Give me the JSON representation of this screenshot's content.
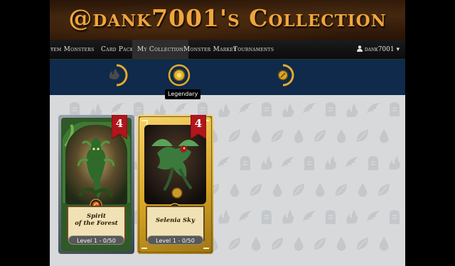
{
  "banner": {
    "title": "@dank7001's Collection"
  },
  "nav": {
    "items": [
      {
        "label": "ŧem Monsters",
        "active": false
      },
      {
        "label": "Card Packs",
        "active": false
      },
      {
        "label": "My Collection",
        "active": true
      },
      {
        "label": "Monster Market",
        "active": false
      },
      {
        "label": "Tournaments",
        "active": false
      }
    ],
    "user": "dank7001"
  },
  "filters": {
    "buttons": [
      "fire-element-icon",
      "legendary-rarity-icon",
      "gold-foil-icon"
    ],
    "tooltip": "Legendary"
  },
  "cards": [
    {
      "name": "Spirit\nof the Forest",
      "mana": "4",
      "level": "Level 1 - 0/50",
      "frame": "earth",
      "accent": "#3f8a3a"
    },
    {
      "name": "Selenia Sky",
      "mana": "4",
      "level": "Level 1 - 0/50",
      "frame": "gold",
      "accent": "#d4a21e"
    }
  ],
  "colors": {
    "accent": "#f0a53c",
    "filterbar": "#0f2a4a",
    "ribbon": "#b0161c"
  }
}
